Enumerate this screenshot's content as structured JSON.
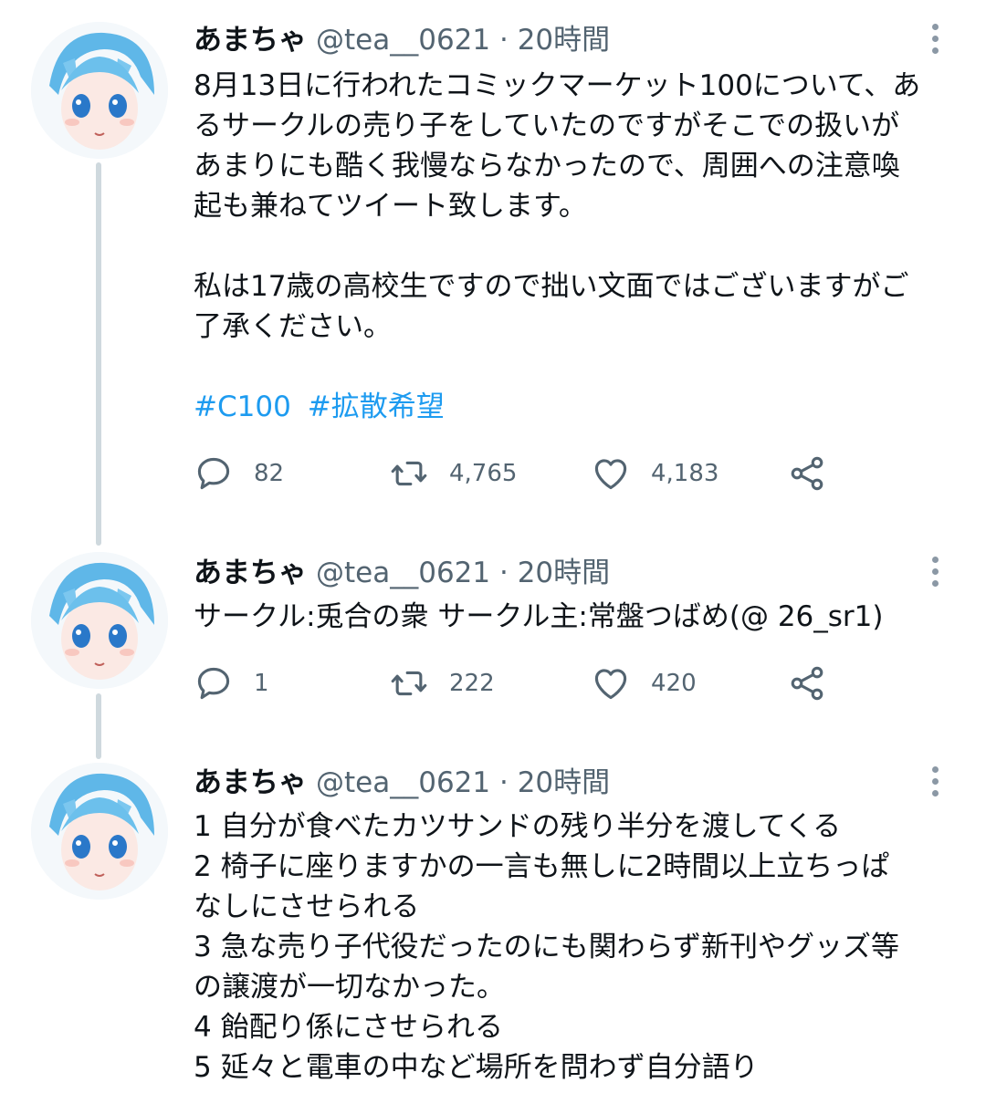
{
  "tweets": [
    {
      "author": "あまちゃ",
      "handle": "@tea__0621",
      "dot": "·",
      "time": "20時間",
      "lines": [
        "8月13日に行われたコミックマーケット100について、あ",
        "るサークルの売り子をしていたのですがそこでの扱いが",
        "あまりにも酷く我慢ならなかったので、周囲への注意喚",
        "起も兼ねてツイート致します。",
        "",
        "私は17歳の高校生ですので拙い文面ではございますがご",
        "了承ください。"
      ],
      "hashtags": [
        "#C100",
        "#拡散希望"
      ],
      "stats": {
        "replies": "82",
        "retweets": "4,765",
        "likes": "4,183"
      }
    },
    {
      "author": "あまちゃ",
      "handle": "@tea__0621",
      "dot": "·",
      "time": "20時間",
      "lines": [
        "サークル:兎合の衆 サークル主:常盤つばめ(@ 26_sr1)"
      ],
      "stats": {
        "replies": "1",
        "retweets": "222",
        "likes": "420"
      }
    },
    {
      "author": "あまちゃ",
      "handle": "@tea__0621",
      "dot": "·",
      "time": "20時間",
      "lines": [
        "1 自分が食べたカツサンドの残り半分を渡してくる",
        "2 椅子に座りますかの一言も無しに2時間以上立ちっぱ",
        "なしにさせられる",
        "3 急な売り子代役だったのにも関わらず新刊やグッズ等",
        "の譲渡が一切なかった。",
        "4 飴配り係にさせられる",
        "5 延々と電車の中など場所を問わず自分語り"
      ]
    }
  ],
  "colors": {
    "link": "#1d9bf0",
    "secondary_text": "#536471",
    "thread_line": "#cfd9de",
    "icon": "#536471"
  },
  "icons": [
    "reply-icon",
    "retweet-icon",
    "like-icon",
    "share-icon",
    "more-icon",
    "avatar"
  ]
}
